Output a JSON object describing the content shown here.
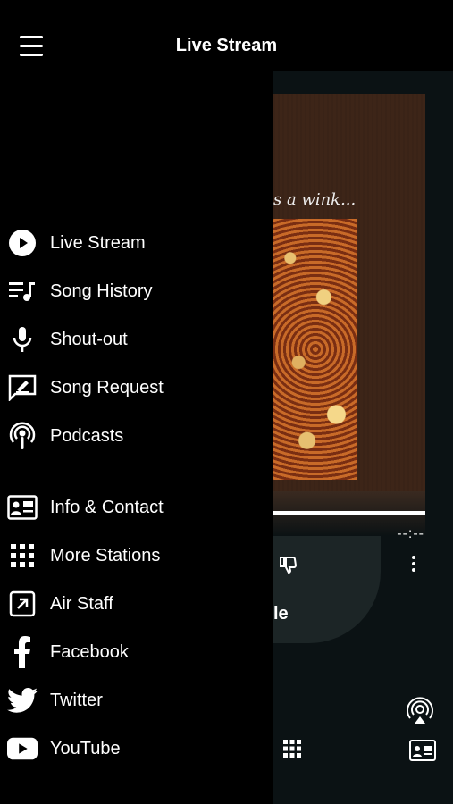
{
  "header": {
    "title": "Live Stream"
  },
  "menu": {
    "group1": [
      {
        "label": "Live Stream",
        "icon": "play-circle-icon"
      },
      {
        "label": "Song History",
        "icon": "playlist-icon"
      },
      {
        "label": "Shout-out",
        "icon": "microphone-icon"
      },
      {
        "label": "Song Request",
        "icon": "request-edit-icon"
      },
      {
        "label": "Podcasts",
        "icon": "podcast-icon"
      }
    ],
    "group2": [
      {
        "label": "Info & Contact",
        "icon": "contact-card-icon"
      },
      {
        "label": "More Stations",
        "icon": "grid-icon"
      },
      {
        "label": "Air Staff",
        "icon": "external-link-icon"
      },
      {
        "label": "Facebook",
        "icon": "facebook-icon"
      },
      {
        "label": "Twitter",
        "icon": "twitter-icon"
      },
      {
        "label": "YouTube",
        "icon": "youtube-icon"
      }
    ]
  },
  "player": {
    "album_text": "s a wink...",
    "time": "--:--",
    "song_fragment": "le",
    "progress": 1.0
  }
}
